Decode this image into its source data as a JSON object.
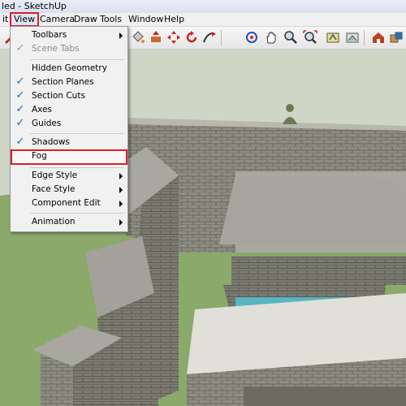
{
  "window": {
    "title": "led - SketchUp"
  },
  "menubar": {
    "items": [
      {
        "label": "it"
      },
      {
        "label": "View"
      },
      {
        "label": "Camera"
      },
      {
        "label": "Draw"
      },
      {
        "label": "Tools"
      },
      {
        "label": "Window"
      },
      {
        "label": "Help"
      }
    ]
  },
  "view_menu": {
    "items": [
      {
        "label": "Toolbars",
        "submenu": true
      },
      {
        "label": "Scene Tabs",
        "checked": true,
        "disabled": true
      },
      {
        "label": "Hidden Geometry"
      },
      {
        "label": "Section Planes",
        "checked": true
      },
      {
        "label": "Section Cuts",
        "checked": true
      },
      {
        "label": "Axes",
        "checked": true
      },
      {
        "label": "Guides",
        "checked": true
      },
      {
        "label": "Shadows",
        "checked": true
      },
      {
        "label": "Fog",
        "highlighted": true
      },
      {
        "label": "Edge Style",
        "submenu": true
      },
      {
        "label": "Face Style",
        "submenu": true
      },
      {
        "label": "Component Edit",
        "submenu": true
      },
      {
        "label": "Animation",
        "submenu": true
      }
    ]
  },
  "toolbar": {
    "icons": [
      "pencil-icon",
      "paint-bucket-icon",
      "push-pull-icon",
      "move-icon",
      "rotate-icon",
      "follow-me-icon",
      "orbit-icon",
      "pan-icon",
      "zoom-icon",
      "zoom-extents-icon",
      "previous-view-icon",
      "next-view-icon",
      "warehouse-icon",
      "components-icon",
      "extension-icon"
    ]
  },
  "colors": {
    "highlight_border": "#d6202a",
    "check": "#1f5fbf",
    "grass": "#8aa96a",
    "stone": "#9a9a8e",
    "water": "#58b4c2"
  }
}
